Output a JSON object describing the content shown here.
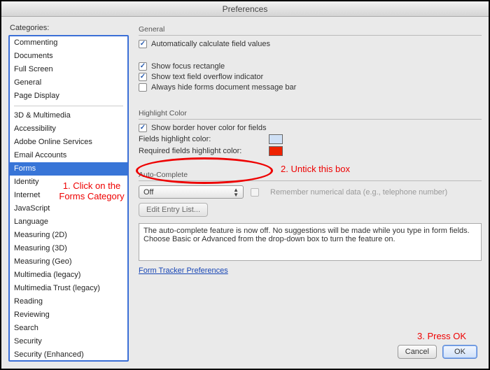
{
  "window": {
    "title": "Preferences"
  },
  "sidebar": {
    "label": "Categories:",
    "groups": [
      [
        "Commenting",
        "Documents",
        "Full Screen",
        "General",
        "Page Display"
      ],
      [
        "3D & Multimedia",
        "Accessibility",
        "Adobe Online Services",
        "Email Accounts",
        "Forms",
        "Identity",
        "Internet",
        "JavaScript",
        "Language",
        "Measuring (2D)",
        "Measuring (3D)",
        "Measuring (Geo)",
        "Multimedia (legacy)",
        "Multimedia Trust (legacy)",
        "Reading",
        "Reviewing",
        "Search",
        "Security",
        "Security (Enhanced)"
      ]
    ],
    "selected": "Forms"
  },
  "general": {
    "heading": "General",
    "auto_calc": "Automatically calculate field values",
    "focus_rect": "Show focus rectangle",
    "overflow": "Show text field overflow indicator",
    "hide_msgbar": "Always hide forms document message bar"
  },
  "highlight": {
    "heading": "Highlight Color",
    "show_border": "Show border hover color for fields",
    "fields_label": "Fields highlight color:",
    "required_label": "Required fields highlight color:"
  },
  "auto": {
    "heading": "Auto-Complete",
    "dropdown_value": "Off",
    "remember": "Remember numerical data (e.g., telephone number)",
    "edit_entry": "Edit Entry List...",
    "description": "The auto-complete feature is now off. No suggestions will be made while you type in form fields. Choose Basic or Advanced from the drop-down box to turn the feature on."
  },
  "link": "Form Tracker Preferences",
  "buttons": {
    "cancel": "Cancel",
    "ok": "OK"
  },
  "annotations": {
    "a1": "1. Click on the\nForms Category",
    "a2": "2. Untick this box",
    "a3": "3. Press OK"
  }
}
